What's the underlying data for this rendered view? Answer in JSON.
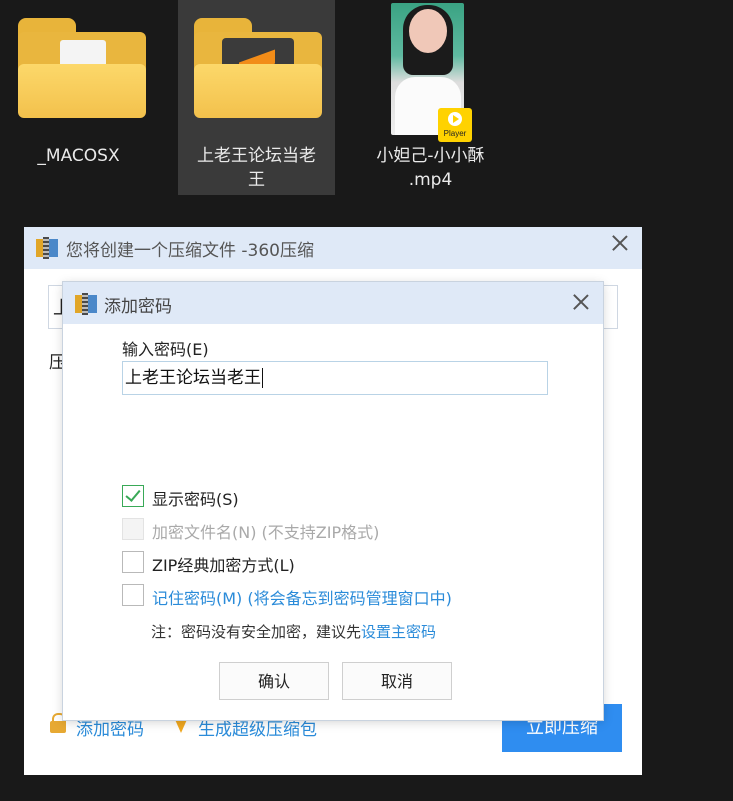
{
  "desktop": {
    "items": [
      {
        "label": "_MACOSX"
      },
      {
        "label": "上老王论坛当老\n王"
      },
      {
        "label": "小妲己-小小酥\n.mp4",
        "badge": "Player"
      }
    ]
  },
  "compress_window": {
    "title": "您将创建一个压缩文件 -360压缩",
    "filename_first_char": "上",
    "section_label_first_char": "压",
    "add_password_link": "添加密码",
    "super_pack_link": "生成超级压缩包",
    "compress_button": "立即压缩"
  },
  "password_dialog": {
    "title": "添加密码",
    "input_label": "输入密码(E)",
    "password_value": "上老王论坛当老王",
    "options": [
      {
        "label": "显示密码(S)",
        "checked": true,
        "disabled": false
      },
      {
        "label": "加密文件名(N) (不支持ZIP格式)",
        "checked": false,
        "disabled": true
      },
      {
        "label": "ZIP经典加密方式(L)",
        "checked": false,
        "disabled": false
      },
      {
        "label": "记住密码(M) (将会备忘到密码管理窗口中)",
        "checked": false,
        "disabled": false
      }
    ],
    "note_prefix": "注：密码没有安全加密，建议先",
    "note_link": "设置主密码",
    "ok_button": "确认",
    "cancel_button": "取消"
  },
  "colors": {
    "accent_blue": "#2f8df0",
    "link_blue": "#2a8bd9",
    "check_green": "#39a957",
    "title_bar": "#dfe9f7"
  },
  "icons": [
    "folder-icon",
    "zip-app-icon",
    "close-icon",
    "lock-icon",
    "super-pack-icon",
    "play-icon",
    "checkbox-checked-icon"
  ]
}
